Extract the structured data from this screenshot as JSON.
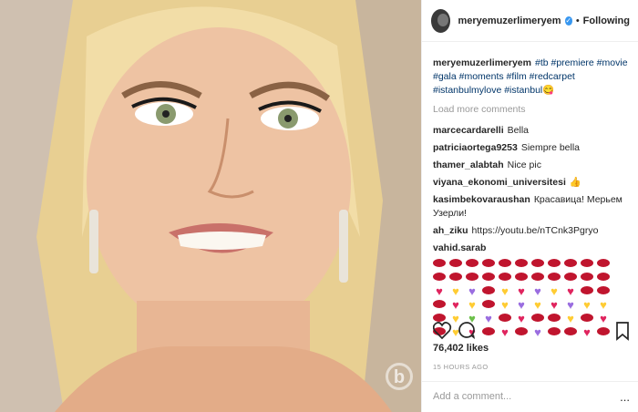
{
  "post": {
    "username": "meryemuzerlimeryem",
    "follow_status": "Following",
    "caption_user": "meryemuzerlimeryem",
    "caption_tags": "#tb #premiere #movie #gala #moments #film #redcarpet #istanbulmylove #istanbul",
    "load_more": "Load more comments",
    "likes": "76,402 likes",
    "time": "15 HOURS AGO",
    "add_comment_placeholder": "Add a comment...",
    "more_options": "..."
  },
  "comments": [
    {
      "user": "marcecardarelli",
      "text": "Bella"
    },
    {
      "user": "patriciaortega9253",
      "text": "Siempre bella"
    },
    {
      "user": "thamer_alabtah",
      "text": "Nice pic"
    },
    {
      "user": "viyana_ekonomi_universitesi",
      "text": "👍"
    },
    {
      "user": "kasimbekovaraushan",
      "text": "Красавица! Мерьем Узерли!"
    },
    {
      "user": "ah_ziku",
      "text": "https://youtu.be/nTCnk3Pgryo"
    },
    {
      "user": "vahid.sarab",
      "text": ""
    }
  ],
  "emoji_rows": [
    [
      "lips",
      "lips",
      "lips",
      "lips",
      "lips",
      "lips",
      "lips",
      "lips",
      "lips",
      "lips",
      "lips"
    ],
    [
      "lips",
      "lips",
      "lips",
      "lips",
      "lips",
      "lips",
      "lips",
      "lips",
      "lips",
      "lips",
      "lips"
    ],
    [
      "heart-red",
      "heart-yellow",
      "heart-purple",
      "lips",
      "heart-yellow",
      "heart-red",
      "heart-purple",
      "heart-yellow",
      "heart-red",
      "lips",
      "lips"
    ],
    [
      "lips",
      "heart-red",
      "heart-yellow",
      "lips",
      "heart-yellow",
      "heart-purple",
      "heart-yellow",
      "heart-red",
      "heart-purple",
      "heart-yellow",
      "heart-yellow"
    ],
    [
      "lips",
      "heart-yellow",
      "heart-green",
      "heart-purple",
      "lips",
      "heart-red",
      "lips",
      "lips",
      "heart-yellow",
      "lips",
      "heart-red"
    ],
    [
      "lips",
      "heart-yellow",
      "heart-red",
      "lips",
      "heart-red",
      "lips",
      "heart-purple",
      "lips",
      "lips",
      "heart-red",
      "lips"
    ]
  ],
  "colors": {
    "verified": "#3897f0",
    "tag_link": "#003569",
    "muted": "#999999",
    "lips": "#c0152e",
    "heart-red": "#e0245e",
    "heart-yellow": "#ffcc33",
    "heart-purple": "#9a6de0",
    "heart-green": "#6cc04a"
  },
  "watermark": "b"
}
